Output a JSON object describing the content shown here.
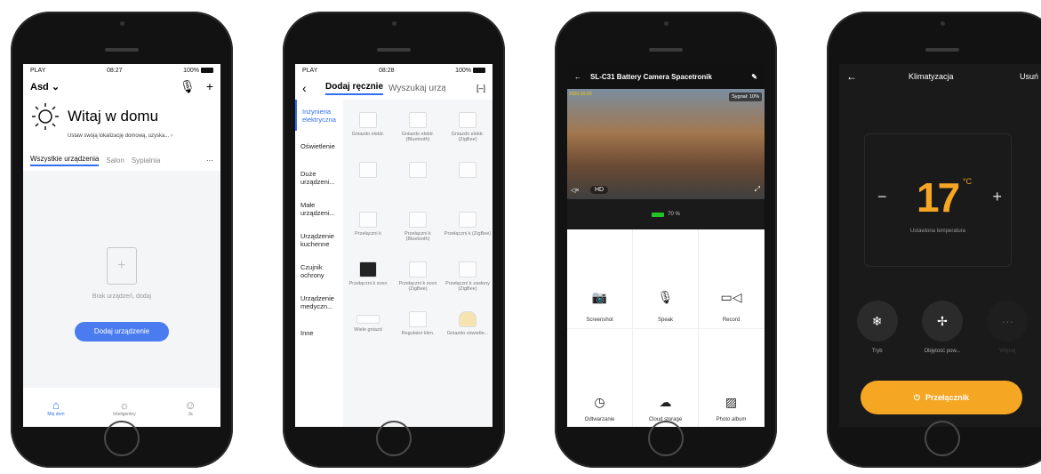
{
  "phone1": {
    "status": {
      "carrier": "PLAY",
      "time": "08:27",
      "battery": "100%"
    },
    "home_name": "Asd",
    "title": "Witaj w domu",
    "subtitle": "Ustaw swoją lokalizację domową, uzyska...",
    "tabs": [
      "Wszystkie urządzenia",
      "Salon",
      "Sypialnia"
    ],
    "empty_text": "Brak urządzeń, dodaj",
    "add_button": "Dodaj urządzenie",
    "nav": [
      "Mój dom",
      "Inteligentny",
      "Ja"
    ]
  },
  "phone2": {
    "status": {
      "carrier": "PLAY",
      "time": "08:28",
      "battery": "100%"
    },
    "tab_manual": "Dodaj ręcznie",
    "tab_search": "Wyszukaj urząd",
    "categories": [
      "Inżynieria elektryczna",
      "Oświetlenie",
      "Duże urządzeni...",
      "Małe urządzeni...",
      "Urządzenie kuchenne",
      "Czujnik ochrony",
      "Urządzenie medyczn...",
      "Inne"
    ],
    "devices": [
      "Gniazdo elektr.",
      "Gniazdo elektr. (Bluetooth)",
      "Gniazdo elektr. (ZigBee)",
      "",
      "",
      "",
      "Przełączni k",
      "Przełączni k (Bluetooth)",
      "Przełączni k (ZigBee)",
      "Przełączni k scen",
      "Przełączni k scen (ZigBee)",
      "Przełączni k zasłony (ZigBee)",
      "Wiele gniazd",
      "Regulator klim.",
      "Gniazdo oświetle..."
    ]
  },
  "phone3": {
    "title": "SL-C31 Battery Camera Spacetronik",
    "timestamp": "2020-10-23",
    "signal": "Sygnał: 10%",
    "quality": "HD",
    "battery": "70 %",
    "actions": [
      "Screenshot",
      "Speak",
      "Record",
      "Odtwarzanie",
      "Cloud storage",
      "Photo album"
    ],
    "icons": [
      "camera-icon",
      "microphone-icon",
      "video-icon",
      "playback-icon",
      "cloud-icon",
      "photo-icon"
    ]
  },
  "phone4": {
    "title": "Klimatyzacja",
    "delete": "Usuń",
    "temperature": "17",
    "unit": "°C",
    "temp_label": "Ustawiona temperatura",
    "controls": [
      "Tryb",
      "Objętość pow...",
      "Więcej"
    ],
    "power_button": "Przełącznik",
    "accent": "#f5a623"
  }
}
